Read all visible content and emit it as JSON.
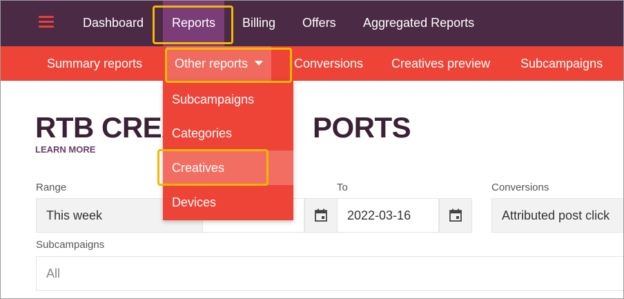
{
  "topnav": {
    "items": [
      {
        "label": "Dashboard"
      },
      {
        "label": "Reports"
      },
      {
        "label": "Billing"
      },
      {
        "label": "Offers"
      },
      {
        "label": "Aggregated Reports"
      }
    ]
  },
  "subnav": {
    "items": [
      {
        "label": "Summary reports"
      },
      {
        "label": "Other reports"
      },
      {
        "label": "Conversions"
      },
      {
        "label": "Creatives preview"
      },
      {
        "label": "Subcampaigns"
      }
    ]
  },
  "dropdown": {
    "items": [
      {
        "label": "Subcampaigns"
      },
      {
        "label": "Categories"
      },
      {
        "label": "Creatives"
      },
      {
        "label": "Devices"
      }
    ]
  },
  "page": {
    "title_left": "RTB CREA",
    "title_right": "PORTS",
    "learn_more": "LEARN MORE"
  },
  "filters": {
    "range_label": "Range",
    "range_value": "This week",
    "to_label": "To",
    "to_value": "2022-03-16",
    "conversions_label": "Conversions",
    "conversions_value": "Attributed post click",
    "subcampaigns_label": "Subcampaigns",
    "subcampaigns_value": "All"
  },
  "colors": {
    "topnav_bg": "#4a2a45",
    "subnav_bg": "#ee4337",
    "highlight": "#f5b800"
  }
}
